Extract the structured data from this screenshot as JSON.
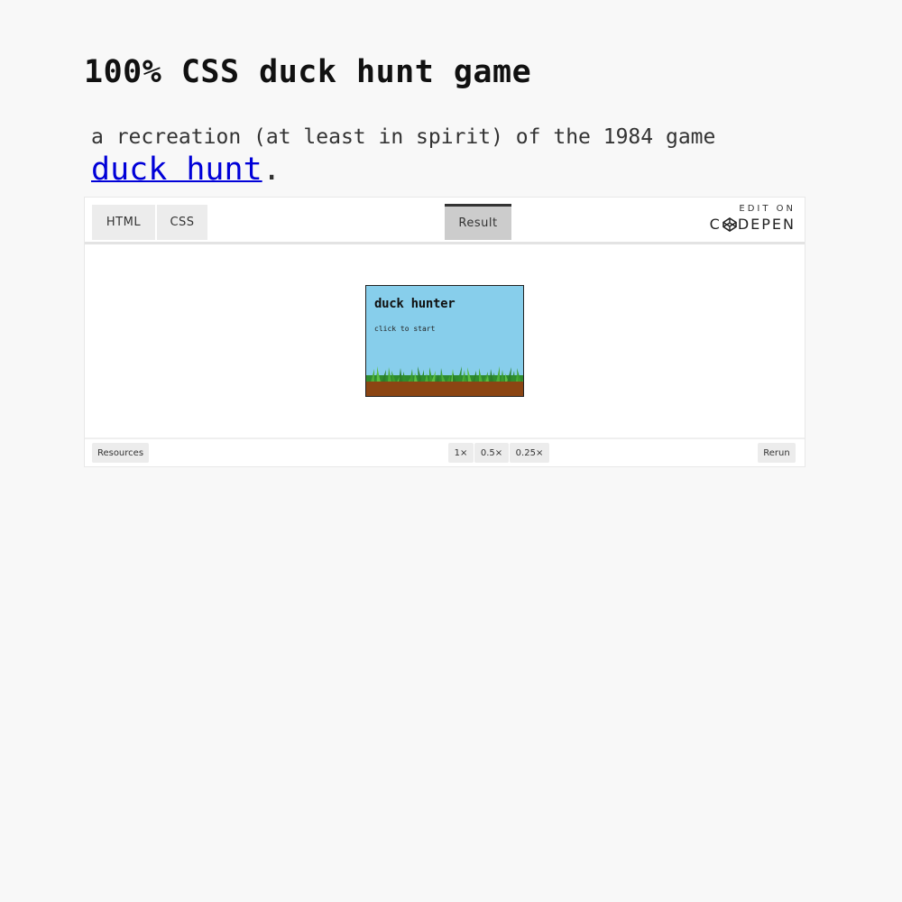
{
  "page": {
    "title": "100% CSS duck hunt game",
    "intro_text": "a recreation (at least in spirit) of the 1984 game",
    "intro_link": "duck hunt",
    "intro_end": "."
  },
  "embed": {
    "tabs": [
      {
        "label": "HTML"
      },
      {
        "label": "CSS"
      },
      {
        "label": "Result",
        "active": true
      }
    ],
    "edit_on": "EDIT ON",
    "codepen_left": "C",
    "codepen_right": "DEPEN",
    "game": {
      "title": "duck hunter",
      "subtitle": "click to start",
      "sky_color": "#87ceeb",
      "grass_color": "#3a9a2a",
      "dirt_color": "#8b4513"
    },
    "footer": {
      "resources": "Resources",
      "zoom_options": [
        "1×",
        "0.5×",
        "0.25×"
      ],
      "rerun": "Rerun"
    }
  }
}
